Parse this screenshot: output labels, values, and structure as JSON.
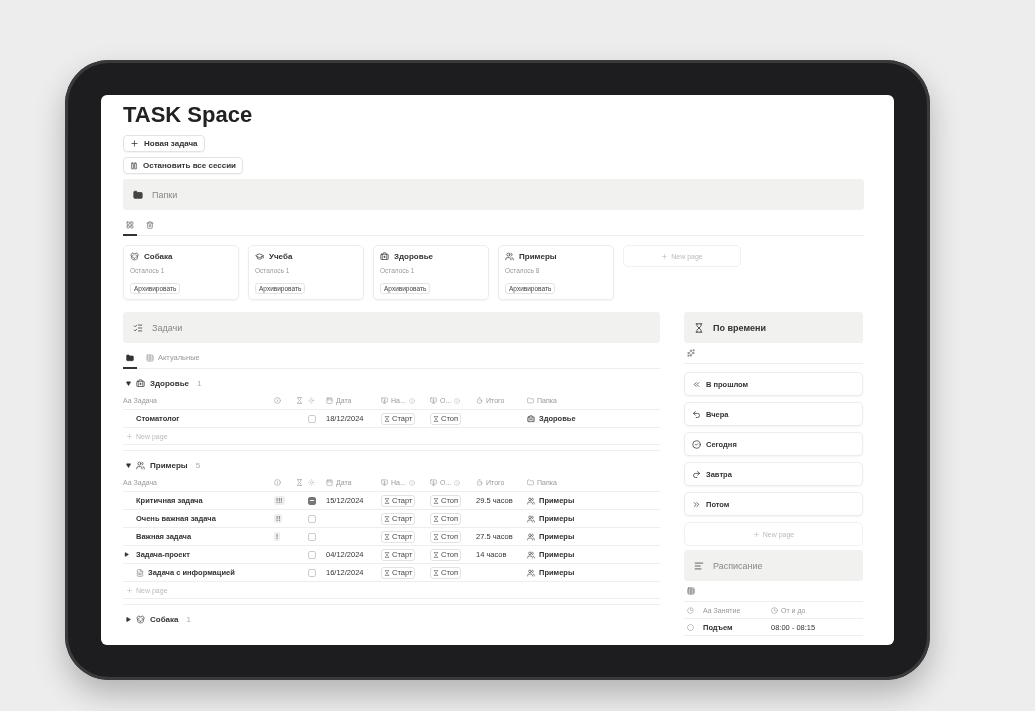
{
  "title": "TASK Space",
  "actions": [
    {
      "kind": "add",
      "label": "Новая задача"
    },
    {
      "kind": "pause",
      "label": "Остановить все сессии"
    }
  ],
  "folders": {
    "heading": "Папки",
    "views": [
      {
        "kind": "grid",
        "selected": true
      },
      {
        "kind": "trash",
        "selected": false
      }
    ],
    "cards": [
      {
        "kind": "dog",
        "name": "Собака",
        "remaining": "Осталось 1",
        "button": "Архивировать"
      },
      {
        "kind": "study",
        "name": "Учеба",
        "remaining": "Осталось 1",
        "button": "Архивировать"
      },
      {
        "kind": "health",
        "name": "Здоровье",
        "remaining": "Осталось 1",
        "button": "Архивировать"
      },
      {
        "kind": "examples",
        "name": "Примеры",
        "remaining": "Осталось 8",
        "button": "Архивировать"
      }
    ],
    "new_page": "New page"
  },
  "tasks": {
    "heading": "Задачи",
    "views": [
      {
        "kind": "folder",
        "selected": true
      },
      {
        "kind": "table",
        "label": "Актуальные",
        "selected": false
      }
    ],
    "groups": [
      {
        "kind": "health",
        "name": "Здоровье",
        "count": "1",
        "expanded": true,
        "columns": [
          {
            "kind": "title",
            "prefix": "Aa",
            "label": "Задача"
          },
          {
            "kind": "date",
            "label": "Дата"
          },
          {
            "kind": "start",
            "label": "На..."
          },
          {
            "kind": "stop",
            "label": "О..."
          },
          {
            "kind": "total",
            "label": "Итого"
          },
          {
            "kind": "folder",
            "label": "Папка"
          }
        ],
        "rows": [
          {
            "kind": "plain",
            "title": "Стоматолог",
            "done": false,
            "date": "18/12/2024",
            "start": "Старт",
            "stop": "Стоп",
            "folder": {
              "kind": "health",
              "label": "Здоровье"
            }
          }
        ],
        "new_page": "New page"
      },
      {
        "kind": "examples",
        "name": "Примеры",
        "count": "5",
        "expanded": true,
        "columns": [
          {
            "kind": "title",
            "prefix": "Aa",
            "label": "Задача"
          },
          {
            "kind": "date",
            "label": "Дата"
          },
          {
            "kind": "start",
            "label": "На..."
          },
          {
            "kind": "stop",
            "label": "О..."
          },
          {
            "kind": "total",
            "label": "Итого"
          },
          {
            "kind": "folder",
            "label": "Папка"
          }
        ],
        "rows": [
          {
            "kind": "plain",
            "title": "Критичная задача",
            "priority": "!!!",
            "done": true,
            "date": "15/12/2024",
            "start": "Старт",
            "stop": "Стоп",
            "total": "29.5 часов",
            "folder": {
              "kind": "examples",
              "label": "Примеры"
            }
          },
          {
            "kind": "plain",
            "title": "Очень важная задача",
            "priority": "!!",
            "done": false,
            "start": "Старт",
            "stop": "Стоп",
            "folder": {
              "kind": "examples",
              "label": "Примеры"
            }
          },
          {
            "kind": "plain",
            "title": "Важная задача",
            "priority": "!",
            "done": false,
            "start": "Старт",
            "stop": "Стоп",
            "total": "27.5 часов",
            "folder": {
              "kind": "examples",
              "label": "Примеры"
            }
          },
          {
            "kind": "parent",
            "title": "Задача-проект",
            "done": false,
            "date": "04/12/2024",
            "start": "Старт",
            "stop": "Стоп",
            "total": "14 часов",
            "folder": {
              "kind": "examples",
              "label": "Примеры"
            }
          },
          {
            "kind": "page",
            "title": "Задача с информацией",
            "done": false,
            "date": "16/12/2024",
            "start": "Старт",
            "stop": "Стоп",
            "folder": {
              "kind": "examples",
              "label": "Примеры"
            }
          }
        ],
        "new_page": "New page"
      },
      {
        "kind": "dog",
        "name": "Собака",
        "count": "1",
        "expanded": false
      }
    ]
  },
  "timeline": {
    "heading": "По времени",
    "items": [
      {
        "kind": "past",
        "label": "В прошлом"
      },
      {
        "kind": "yesterday",
        "label": "Вчера"
      },
      {
        "kind": "today",
        "label": "Сегодня"
      },
      {
        "kind": "tomorrow",
        "label": "Завтра"
      },
      {
        "kind": "later",
        "label": "Потом"
      }
    ],
    "new_page": "New page"
  },
  "schedule": {
    "heading": "Расписание",
    "columns": [
      {
        "kind": "title",
        "prefix": "Aa",
        "label": "Занятие"
      },
      {
        "kind": "time",
        "label": "От и до"
      }
    ],
    "rows": [
      {
        "name": "Подъем",
        "time": "08:00 - 08:15"
      }
    ]
  }
}
